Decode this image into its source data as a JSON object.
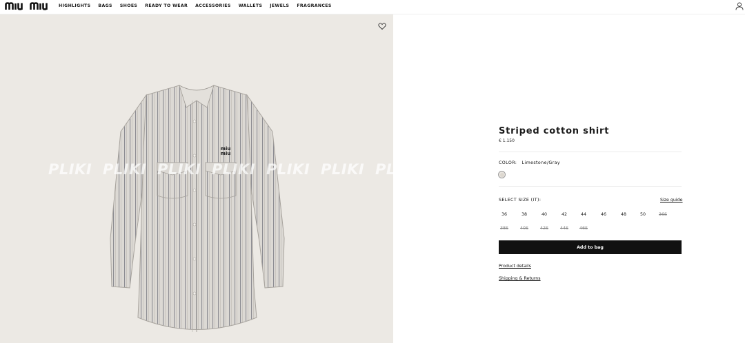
{
  "header": {
    "logo_text": "miu miu",
    "nav": [
      "HIGHLIGHTS",
      "BAGS",
      "SHOES",
      "READY TO WEAR",
      "ACCESSORIES",
      "WALLETS",
      "JEWELS",
      "FRAGRANCES"
    ]
  },
  "gallery": {
    "watermark": "PLIKI",
    "shirt_logo": "miu miu"
  },
  "product": {
    "title": "Striped cotton shirt",
    "price": "€ 1.150",
    "color_label": "COLOR:",
    "color_value": "Limestone/Gray",
    "size_label": "SELECT SIZE (IT):",
    "size_guide": "Size guide",
    "sizes_row1": [
      {
        "label": "36",
        "available": true
      },
      {
        "label": "38",
        "available": true
      },
      {
        "label": "40",
        "available": true
      },
      {
        "label": "42",
        "available": true
      },
      {
        "label": "44",
        "available": true
      },
      {
        "label": "46",
        "available": true
      },
      {
        "label": "48",
        "available": true
      },
      {
        "label": "50",
        "available": true
      },
      {
        "label": "36S",
        "available": false
      }
    ],
    "sizes_row2": [
      {
        "label": "38S",
        "available": false
      },
      {
        "label": "40S",
        "available": false
      },
      {
        "label": "42S",
        "available": false
      },
      {
        "label": "44S",
        "available": false
      },
      {
        "label": "46S",
        "available": false
      }
    ],
    "add_to_bag": "Add to bag",
    "product_details": "Product details",
    "shipping_returns": "Shipping & Returns"
  },
  "colors": {
    "accent": "#111111",
    "image_bg": "#ece9e4"
  }
}
